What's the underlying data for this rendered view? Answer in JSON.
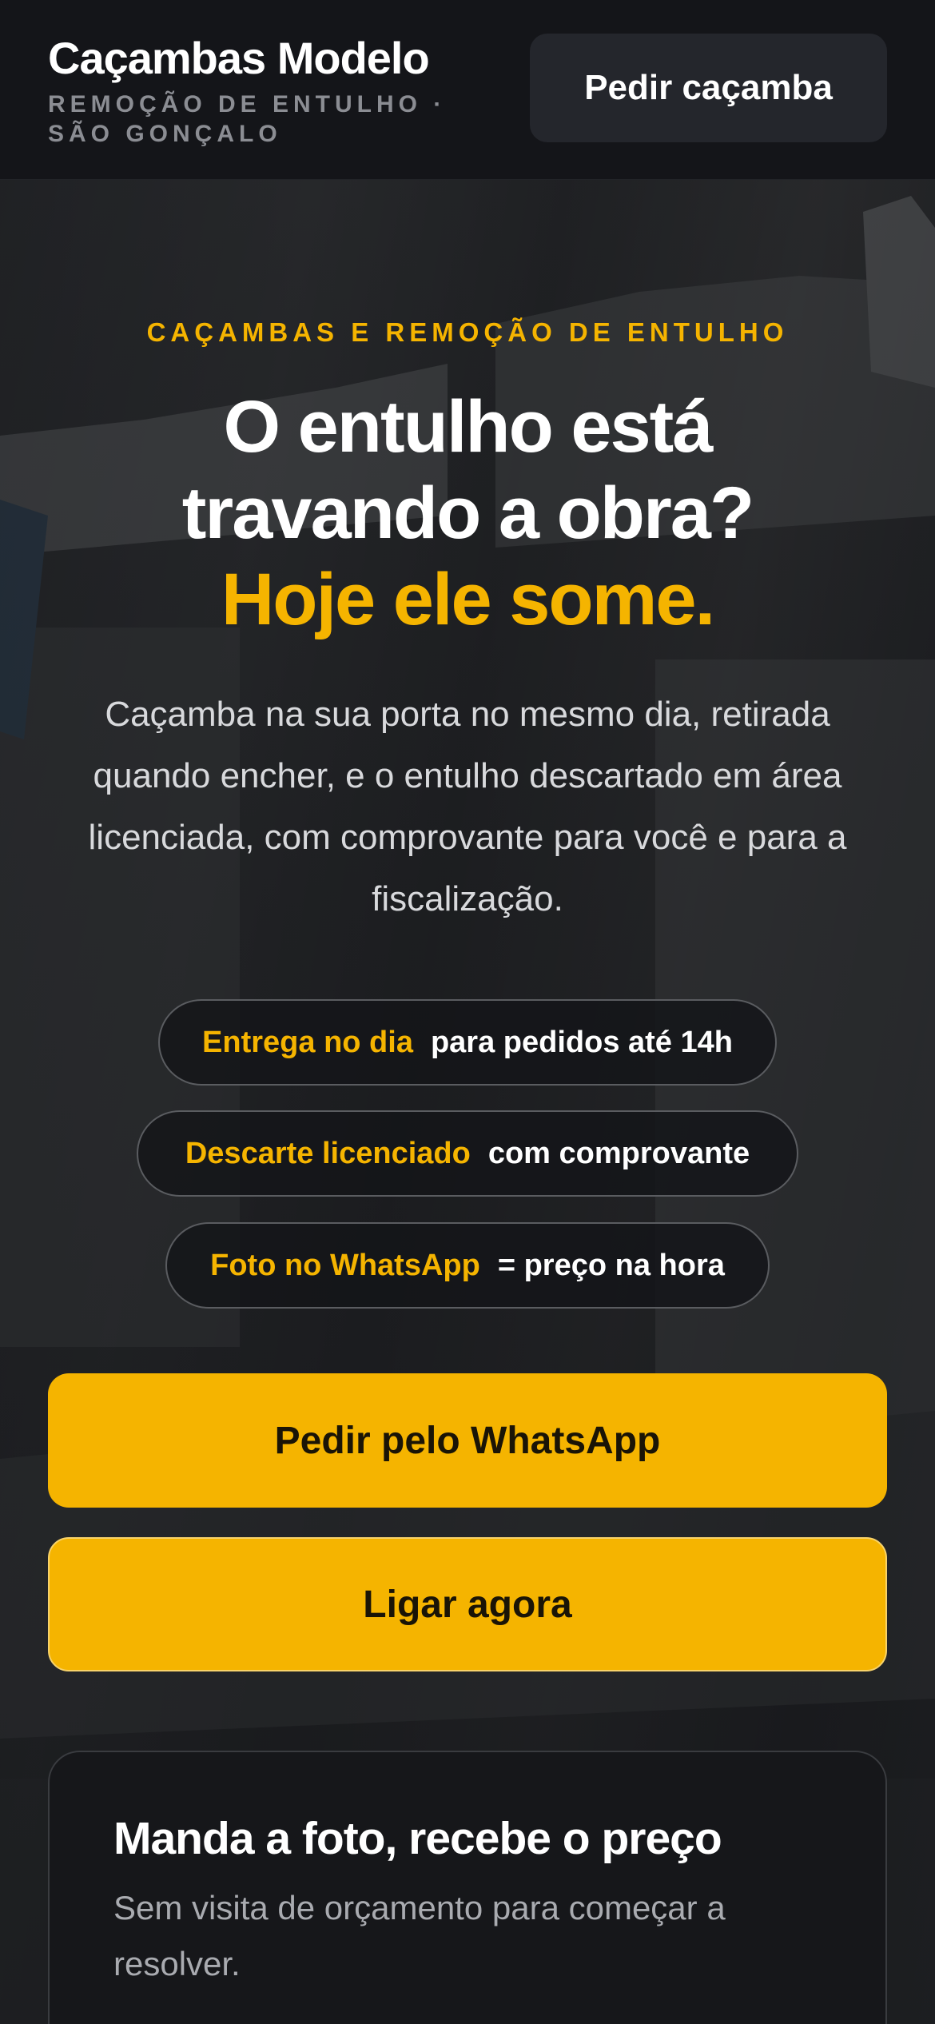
{
  "header": {
    "brand_name": "Caçambas Modelo",
    "brand_subtitle": "REMOÇÃO DE ENTULHO · SÃO GONÇALO",
    "cta_label": "Pedir caçamba"
  },
  "hero": {
    "eyebrow": "CAÇAMBAS E REMOÇÃO DE ENTULHO",
    "headline_line1": "O entulho está",
    "headline_line2": "travando a obra?",
    "headline_accent": "Hoje ele some.",
    "subtext": "Caçamba na sua porta no mesmo dia, retirada quando encher, e o entulho descartado em área licenciada, com comprovante para você e para a fiscalização.",
    "pills": [
      {
        "accent": "Entrega no dia",
        "rest": "para pedidos até 14h"
      },
      {
        "accent": "Descarte licenciado",
        "rest": "com comprovante"
      },
      {
        "accent": "Foto no WhatsApp",
        "rest": "= preço na hora"
      }
    ],
    "primary_cta": "Pedir pelo WhatsApp",
    "secondary_cta": "Ligar agora"
  },
  "quote_card": {
    "title": "Manda a foto, recebe o preço",
    "text": "Sem visita de orçamento para começar a resolver."
  },
  "colors": {
    "accent": "#f5b400",
    "header_bg": "#141519",
    "card_bg": "#16171a"
  }
}
